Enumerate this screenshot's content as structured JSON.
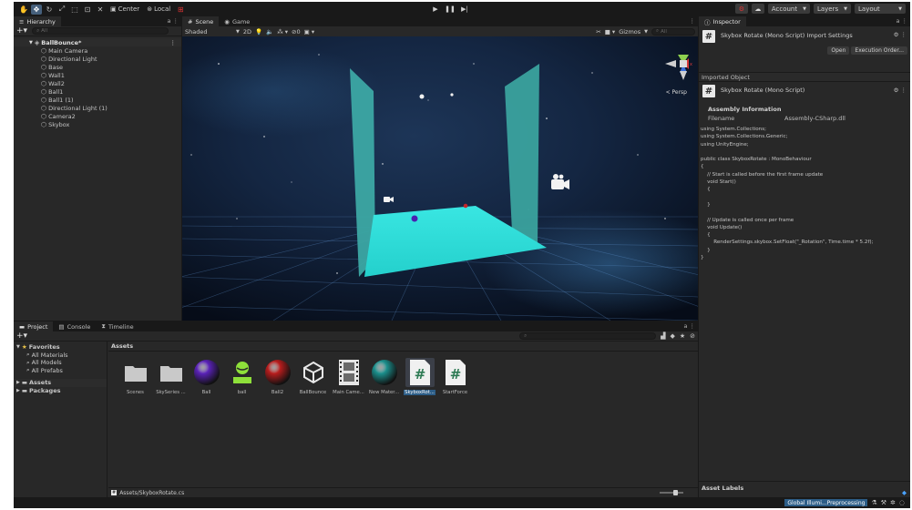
{
  "toolbar": {
    "center_label": "Center",
    "local_label": "Local",
    "account_label": "Account",
    "layers_label": "Layers",
    "layout_label": "Layout"
  },
  "hierarchy": {
    "tab": "Hierarchy",
    "search_placeholder": "All",
    "root": "BallBounce*",
    "items": [
      "Main Camera",
      "Directional Light",
      "Base",
      "Wall1",
      "Wall2",
      "Ball1",
      "Ball1 (1)",
      "Directional Light (1)",
      "Camera2",
      "Skybox"
    ]
  },
  "scene": {
    "tabs": [
      "Scene",
      "Game"
    ],
    "shading_mode": "Shaded",
    "mode_2d": "2D",
    "gizmos_label": "Gizmos",
    "search_placeholder": "All",
    "view_label": "< Persp",
    "colors": {
      "wall": "#3aa7a3",
      "floor": "#2fe0dc",
      "sky": "#0d1b33",
      "ball_red": "#c0262a",
      "ball_purple": "#4a1fb0"
    }
  },
  "inspector": {
    "tab": "Inspector",
    "title": "Skybox Rotate (Mono Script) Import Settings",
    "open_button": "Open",
    "exec_order_button": "Execution Order...",
    "imported_object_label": "Imported Object",
    "object_name": "Skybox Rotate (Mono Script)",
    "assembly_title": "Assembly Information",
    "filename_key": "Filename",
    "filename_value": "Assembly-CSharp.dll",
    "code": "using System.Collections;\nusing System.Collections.Generic;\nusing UnityEngine;\n\npublic class SkyboxRotate : MonoBehaviour\n{\n    // Start is called before the first frame update\n    void Start()\n    {\n\n    }\n\n    // Update is called once per frame\n    void Update()\n    {\n        RenderSettings.skybox.SetFloat(\"_Rotation\", Time.time * 5.2f);\n    }\n}",
    "asset_labels": "Asset Labels"
  },
  "project": {
    "tabs": [
      "Project",
      "Console",
      "Timeline"
    ],
    "favorites_label": "Favorites",
    "favorites": [
      "All Materials",
      "All Models",
      "All Prefabs"
    ],
    "folders": [
      "Assets",
      "Packages"
    ],
    "breadcrumb": "Assets",
    "assets": [
      {
        "label": "Scenes",
        "icon": "folder-icon"
      },
      {
        "label": "SkySeries ...",
        "icon": "folder-icon"
      },
      {
        "label": "Ball",
        "icon": "material-sphere-icon",
        "color": "#5a22b8"
      },
      {
        "label": "ball",
        "icon": "physics-material-icon",
        "color": "#8ee03a"
      },
      {
        "label": "Ball2",
        "icon": "material-sphere-icon",
        "color": "#b81d1d"
      },
      {
        "label": "BallBounce",
        "icon": "unity-scene-icon"
      },
      {
        "label": "Main Came...",
        "icon": "film-strip-icon"
      },
      {
        "label": "New Mater...",
        "icon": "material-sphere-icon",
        "color": "#1b8f8c"
      },
      {
        "label": "SkyboxRot...",
        "icon": "cs-script-icon"
      },
      {
        "label": "StartForce",
        "icon": "cs-script-icon"
      }
    ],
    "path": "Assets/SkyboxRotate.cs"
  },
  "status": {
    "progress_label": "Global Illumi...Preprocessing"
  }
}
